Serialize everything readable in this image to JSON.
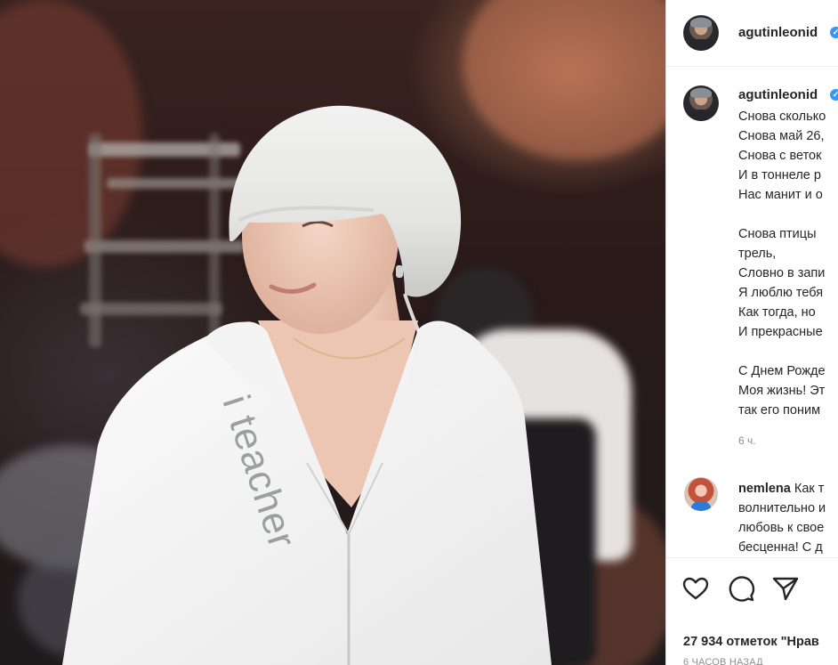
{
  "post": {
    "username": "agutinleonid",
    "caption_lines": [
      "Снова сколько",
      "Снова май 26,",
      "Снова с веток",
      "И в тоннеле р",
      "Нас манит и о",
      "",
      "Снова птицы",
      "трель,",
      "Словно в запи",
      "Я люблю тебя",
      "Как тогда, но",
      "И прекрасные",
      "",
      "С Днем Рожде",
      "Моя жизнь! Эт",
      "так его поним"
    ],
    "time_ago": "6 ч.",
    "likes_text": "27 934 отметок \"Нрав",
    "posted_ago": "6 ЧАСОВ НАЗАД",
    "shirt_print": "i teacher"
  },
  "comment": {
    "username": "nemlena",
    "lines": [
      "Как т",
      "волнительно и",
      "любовь к свое",
      "бесценна! С д"
    ]
  },
  "icons": {
    "verified": "verified-badge-icon",
    "like": "heart-icon",
    "comment": "comment-bubble-icon",
    "share": "paper-plane-icon"
  },
  "colors": {
    "verified_blue": "#3897f0",
    "text": "#262626",
    "muted": "#8e8e8e"
  }
}
